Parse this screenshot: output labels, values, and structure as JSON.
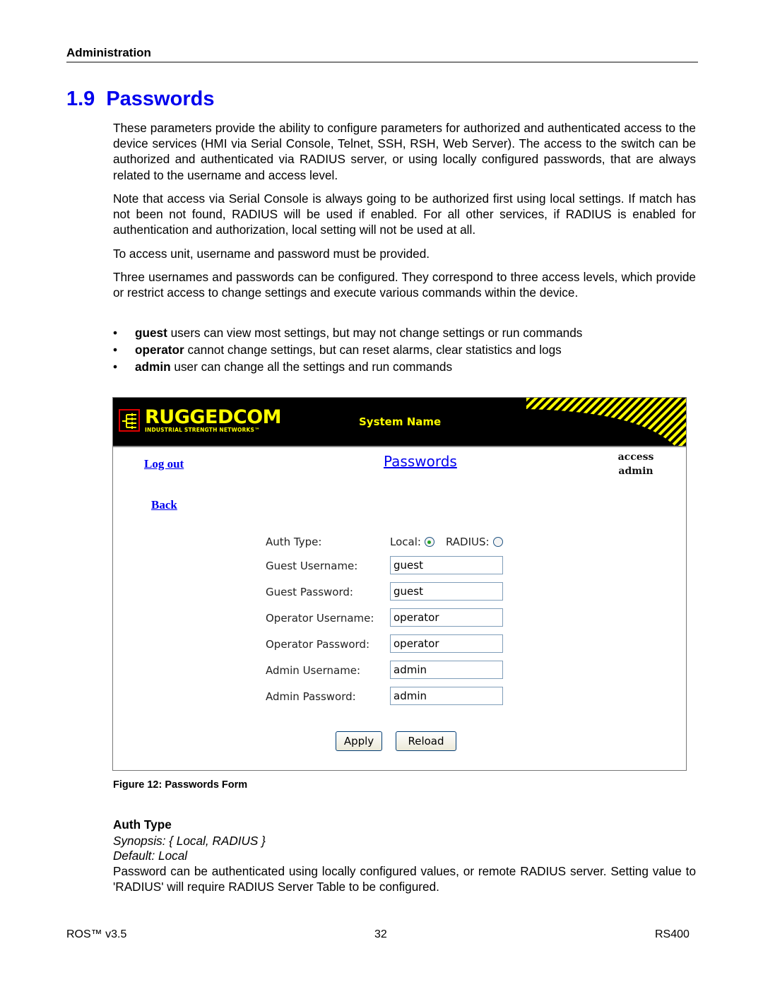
{
  "document": {
    "running_header": "Administration",
    "section_number": "1.9",
    "section_title": "Passwords",
    "paragraphs": [
      "These parameters provide the ability to configure parameters for authorized and authenticated access to the device services (HMI via Serial Console, Telnet, SSH, RSH, Web Server). The access to the switch can be authorized and authenticated via RADIUS server, or using locally configured passwords, that are always related to the username and access level.",
      "Note that access via Serial Console is always going to be authorized first using local settings. If match has not been not found, RADIUS will be used if enabled. For all other services, if RADIUS is enabled for authentication and authorization, local setting will not be used at all.",
      "To access unit, username and password must be provided.",
      "Three usernames and passwords can be configured. They correspond to three access levels, which provide or restrict access to change settings and execute various commands within the device."
    ],
    "bullets": [
      {
        "term": "guest",
        "text": " users can view most settings, but may not change settings or run commands"
      },
      {
        "term": "operator",
        "text": " cannot change settings, but can reset alarms, clear statistics and logs"
      },
      {
        "term": "admin",
        "text": " user can change all the settings and run commands"
      }
    ],
    "bullet_glyph": "•",
    "figure_caption": "Figure 12: Passwords Form",
    "parameter": {
      "name": "Auth Type",
      "synopsis": "Synopsis: { Local, RADIUS }",
      "default": "Default: Local",
      "description": "Password can be authenticated using locally configured values, or remote RADIUS server. Setting value to 'RADIUS' will require RADIUS Server Table to be configured."
    },
    "footer": {
      "left": "ROS™  v3.5",
      "center": "32",
      "right": "RS400"
    }
  },
  "screenshot": {
    "brand": {
      "name": "RUGGEDCOM",
      "tagline": "INDUSTRIAL STRENGTH NETWORKS™",
      "logo_icon": "network-tree-icon"
    },
    "system_name": "System Name",
    "logout_label": "Log out",
    "back_label": "Back",
    "page_heading": "Passwords",
    "access": {
      "label": "access",
      "level": "admin"
    },
    "auth_type": {
      "label": "Auth Type:",
      "options": [
        {
          "label": "Local:",
          "checked": true
        },
        {
          "label": "RADIUS:",
          "checked": false
        }
      ]
    },
    "fields": [
      {
        "label": "Guest Username:",
        "value": "guest"
      },
      {
        "label": "Guest Password:",
        "value": "guest"
      },
      {
        "label": "Operator Username:",
        "value": "operator"
      },
      {
        "label": "Operator Password:",
        "value": "operator"
      },
      {
        "label": "Admin Username:",
        "value": "admin"
      },
      {
        "label": "Admin Password:",
        "value": "admin"
      }
    ],
    "buttons": {
      "apply": "Apply",
      "reload": "Reload"
    },
    "colors": {
      "banner_bg": "#000000",
      "brand_yellow": "#ffff00",
      "link_blue": "#0000ee",
      "logo_red": "#dd0000"
    }
  }
}
